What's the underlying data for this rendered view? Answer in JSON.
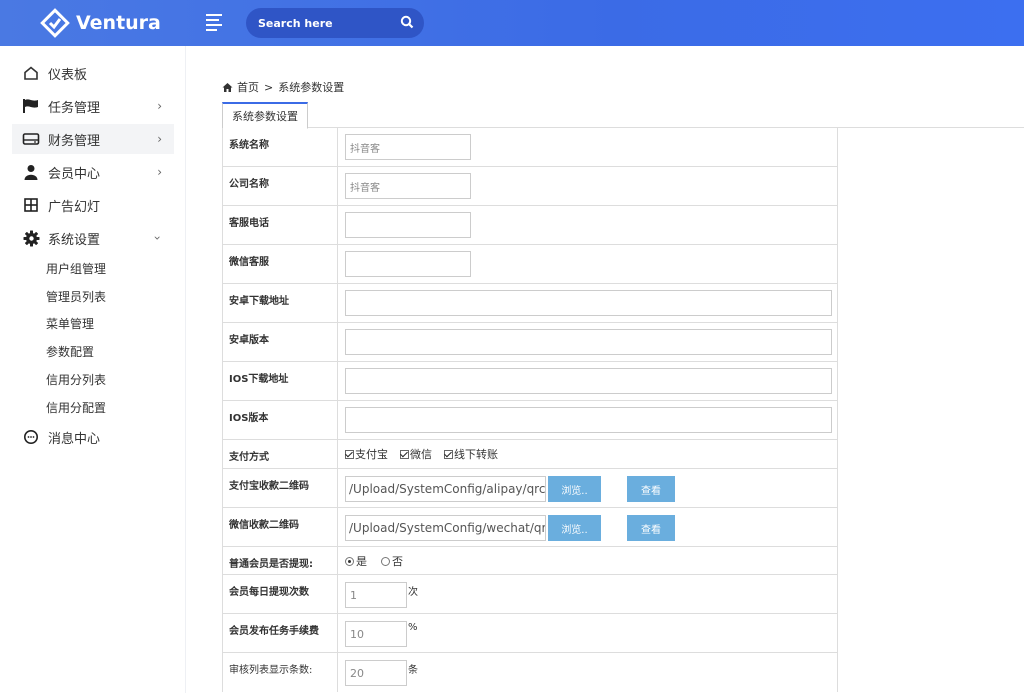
{
  "app": {
    "brand": "Ventura"
  },
  "header": {
    "search_placeholder": "Search here"
  },
  "sidebar": {
    "items": [
      {
        "label": "仪表板",
        "icon": "home-icon"
      },
      {
        "label": "任务管理",
        "icon": "flag-icon"
      },
      {
        "label": "财务管理",
        "icon": "drive-icon"
      },
      {
        "label": "会员中心",
        "icon": "user-icon"
      },
      {
        "label": "广告幻灯",
        "icon": "grid-icon"
      },
      {
        "label": "系统设置",
        "icon": "gear-icon"
      },
      {
        "label": "消息中心",
        "icon": "chat-icon"
      }
    ],
    "sub_items": [
      "用户组管理",
      "管理员列表",
      "菜单管理",
      "参数配置",
      "信用分列表",
      "信用分配置"
    ]
  },
  "breadcrumb": {
    "home": "首页",
    "separator": ">",
    "current": "系统参数设置"
  },
  "tab": {
    "label": "系统参数设置"
  },
  "form": {
    "system_name": {
      "label": "系统名称",
      "value": "抖音客"
    },
    "company_name": {
      "label": "公司名称",
      "value": "抖音客"
    },
    "service_phone": {
      "label": "客服电话",
      "value": ""
    },
    "wechat_service": {
      "label": "微信客服",
      "value": ""
    },
    "android_url": {
      "label": "安卓下载地址",
      "value": ""
    },
    "android_version": {
      "label": "安卓版本",
      "value": ""
    },
    "ios_url": {
      "label": "IOS下载地址",
      "value": ""
    },
    "ios_version": {
      "label": "IOS版本",
      "value": ""
    },
    "payment": {
      "label": "支付方式",
      "options": [
        "支付宝",
        "微信",
        "线下转账"
      ]
    },
    "alipay_qr": {
      "label": "支付宝收款二维码",
      "value": "/Upload/SystemConfig/alipay/qrcode,",
      "browse": "浏览..",
      "view": "查看"
    },
    "wechat_qr": {
      "label": "微信收款二维码",
      "value": "/Upload/SystemConfig/wechat/qrcode",
      "browse": "浏览..",
      "view": "查看"
    },
    "member_withdraw": {
      "label": "普通会员是否提现:",
      "yes": "是",
      "no": "否"
    },
    "daily_withdraw": {
      "label": "会员每日提现次数",
      "value": "1",
      "unit": "次"
    },
    "task_fee": {
      "label": "会员发布任务手续费",
      "value": "10",
      "unit": "%"
    },
    "audit_list_count": {
      "label": "审核列表显示条数:",
      "value": "20",
      "unit": "条"
    }
  },
  "colors": {
    "header": "#3b6be6",
    "button": "#6aaede"
  }
}
